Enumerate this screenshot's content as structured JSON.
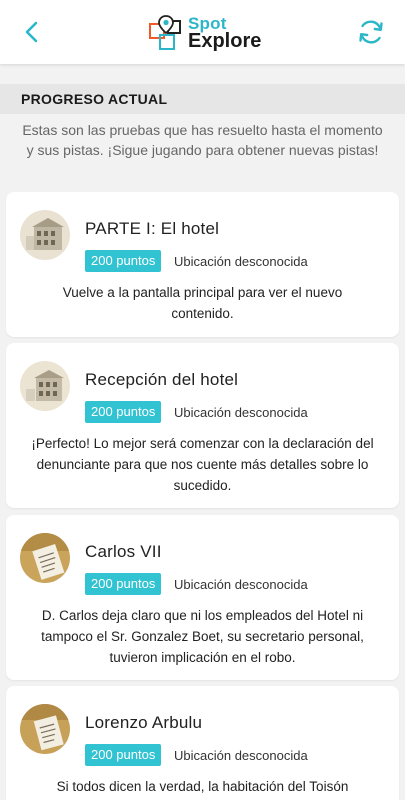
{
  "header": {
    "logo_top": "Spot",
    "logo_bottom": "Explore",
    "accent_color": "#2bb7c8"
  },
  "section": {
    "title": "PROGRESO ACTUAL",
    "intro": "Estas son las pruebas que has resuelto hasta el momento y sus pistas. ¡Sigue jugando para obtener nuevas pistas!"
  },
  "cards": [
    {
      "title": "PARTE I: El hotel",
      "points": "200 puntos",
      "location": "Ubicación desconocida",
      "description": "Vuelve a la pantalla principal para ver el nuevo contenido."
    },
    {
      "title": "Recepción del hotel",
      "points": "200 puntos",
      "location": "Ubicación desconocida",
      "description": "¡Perfecto! Lo mejor será comenzar con la declaración del denunciante para que nos cuente más detalles sobre lo sucedido."
    },
    {
      "title": "Carlos VII",
      "points": "200 puntos",
      "location": "Ubicación desconocida",
      "description": "D. Carlos deja claro que ni los empleados del Hotel ni tampoco el Sr. Gonzalez Boet, su secretario personal, tuvieron implicación en el robo."
    },
    {
      "title": "Lorenzo Arbulu",
      "points": "200 puntos",
      "location": "Ubicación desconocida",
      "description": "Si todos dicen la verdad, la habitación del Toisón"
    }
  ]
}
